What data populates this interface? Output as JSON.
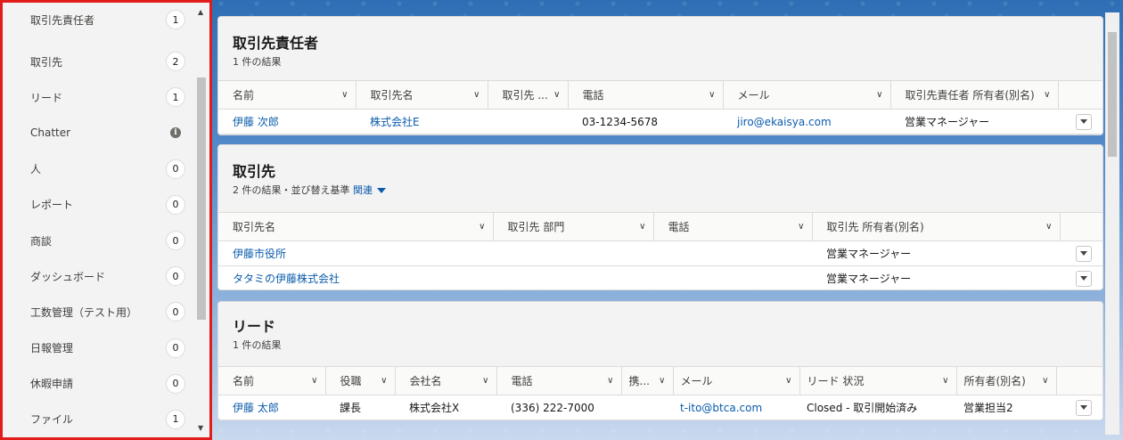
{
  "sidebar": {
    "items": [
      {
        "label": "取引先責任者",
        "count": "1"
      },
      {
        "label": "取引先",
        "count": "2"
      },
      {
        "label": "リード",
        "count": "1"
      },
      {
        "label": "Chatter",
        "count": ""
      },
      {
        "label": "人",
        "count": "0"
      },
      {
        "label": "レポート",
        "count": "0"
      },
      {
        "label": "商談",
        "count": "0"
      },
      {
        "label": "ダッシュボード",
        "count": "0"
      },
      {
        "label": "工数管理（テスト用）",
        "count": "0"
      },
      {
        "label": "日報管理",
        "count": "0"
      },
      {
        "label": "休暇申請",
        "count": "0"
      },
      {
        "label": "ファイル",
        "count": "1"
      }
    ],
    "chatter_info_glyph": "i"
  },
  "contacts": {
    "title": "取引先責任者",
    "subtitle": "1 件の結果",
    "headers": [
      "名前",
      "取引先名",
      "取引先 ...",
      "電話",
      "メール",
      "取引先責任者 所有者(別名)"
    ],
    "rows": [
      [
        "伊藤 次郎",
        "株式会社E",
        "",
        "03-1234-5678",
        "jiro@ekaisya.com",
        "営業マネージャー"
      ]
    ]
  },
  "accounts": {
    "title": "取引先",
    "subtitle": "2 件の結果・並び替え基準",
    "sort_label": "関連",
    "headers": [
      "取引先名",
      "取引先 部門",
      "電話",
      "取引先 所有者(別名)"
    ],
    "rows": [
      [
        "伊藤市役所",
        "",
        "",
        "営業マネージャー"
      ],
      [
        "タタミの伊藤株式会社",
        "",
        "",
        "営業マネージャー"
      ]
    ]
  },
  "leads": {
    "title": "リード",
    "subtitle": "1 件の結果",
    "headers": [
      "名前",
      "役職",
      "会社名",
      "電話",
      "携...",
      "メール",
      "リード 状況",
      "所有者(別名)"
    ],
    "rows": [
      [
        "伊藤 太郎",
        "課長",
        "株式会社X",
        "(336) 222-7000",
        "",
        "t-ito@btca.com",
        "Closed - 取引開始済み",
        "営業担当2"
      ]
    ]
  },
  "colors": {
    "highlight_border": "#e21b1b",
    "link": "#0b5cab"
  }
}
